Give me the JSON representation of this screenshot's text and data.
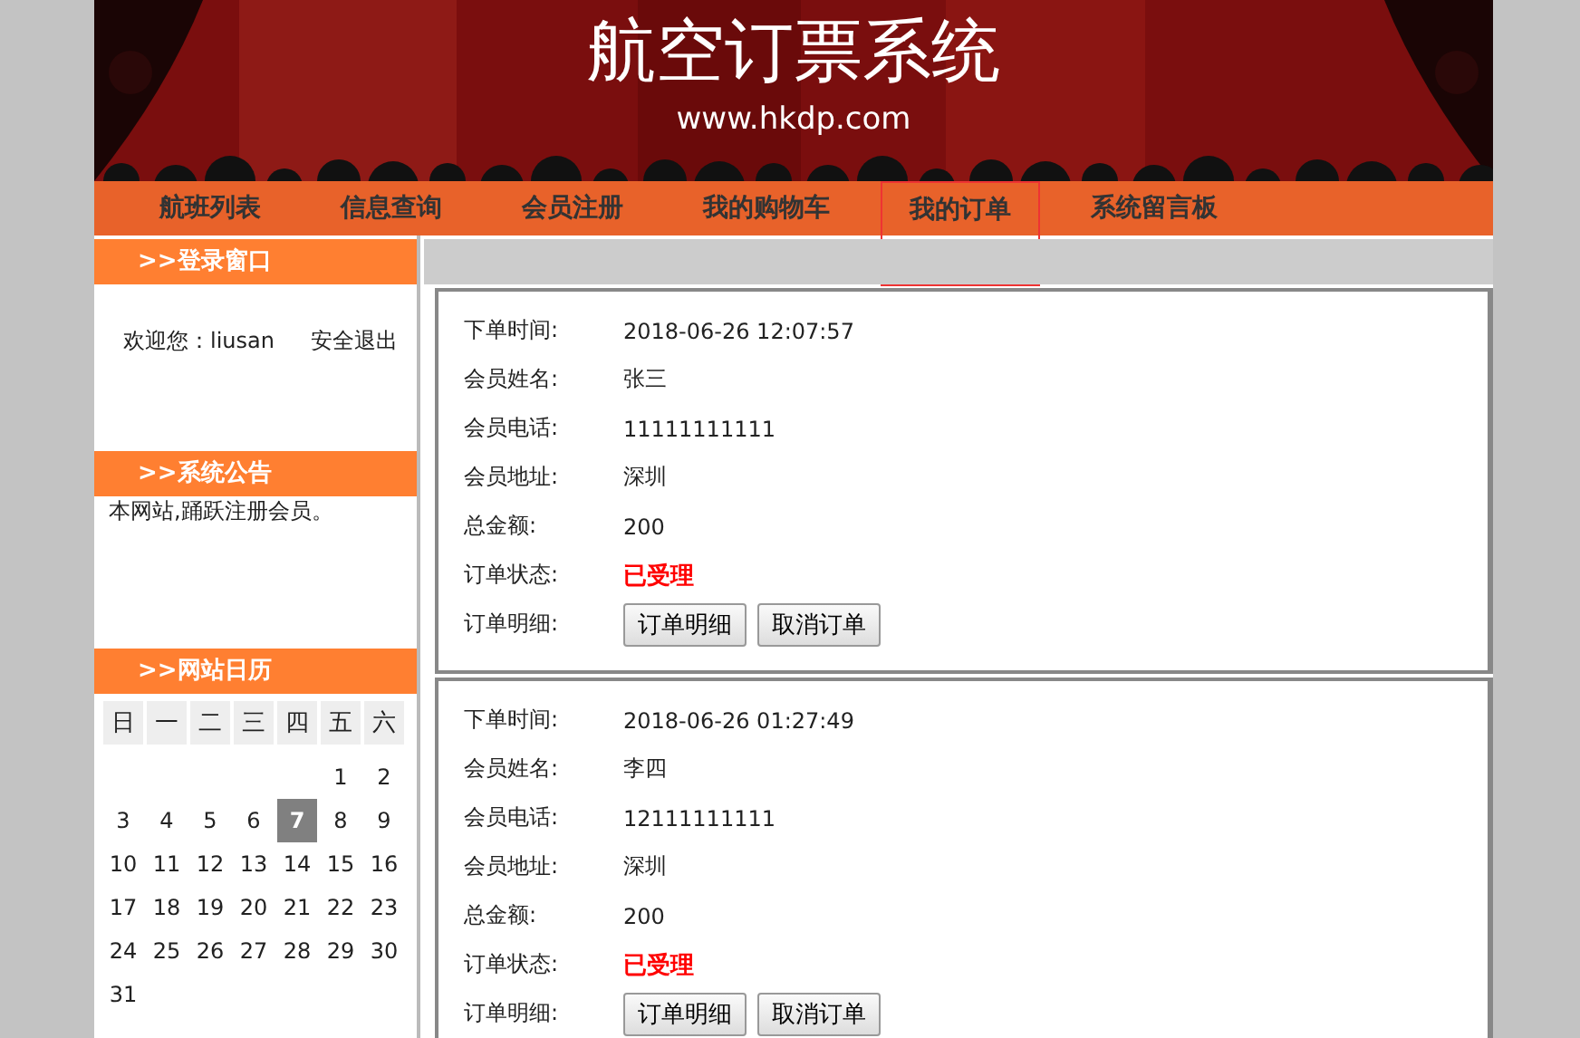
{
  "banner": {
    "title": "航空订票系统",
    "url": "www.hkdp.com"
  },
  "nav": [
    {
      "label": "航班列表",
      "selected": false
    },
    {
      "label": "信息查询",
      "selected": false
    },
    {
      "label": "会员注册",
      "selected": false
    },
    {
      "label": "我的购物车",
      "selected": false
    },
    {
      "label": "我的订单",
      "selected": true
    },
    {
      "label": "系统留言板",
      "selected": false
    }
  ],
  "login": {
    "title": ">>登录窗口",
    "welcome": "欢迎您：liusan",
    "logout": "安全退出"
  },
  "notice": {
    "title": ">>系统公告",
    "text": "本网站,踊跃注册会员。"
  },
  "calendar": {
    "title": ">>网站日历",
    "weekdays": [
      "日",
      "一",
      "二",
      "三",
      "四",
      "五",
      "六"
    ],
    "days": [
      {
        "day": "1",
        "selected": false
      },
      {
        "day": "2",
        "selected": false
      },
      {
        "day": "3",
        "selected": false
      },
      {
        "day": "4",
        "selected": false
      },
      {
        "day": "5",
        "selected": false
      },
      {
        "day": "6",
        "selected": false
      },
      {
        "day": "7",
        "selected": true
      },
      {
        "day": "8",
        "selected": false
      },
      {
        "day": "9",
        "selected": false
      },
      {
        "day": "10",
        "selected": false
      },
      {
        "day": "11",
        "selected": false
      },
      {
        "day": "12",
        "selected": false
      },
      {
        "day": "13",
        "selected": false
      },
      {
        "day": "14",
        "selected": false
      },
      {
        "day": "15",
        "selected": false
      },
      {
        "day": "16",
        "selected": false
      },
      {
        "day": "17",
        "selected": false
      },
      {
        "day": "18",
        "selected": false
      },
      {
        "day": "19",
        "selected": false
      },
      {
        "day": "20",
        "selected": false
      },
      {
        "day": "21",
        "selected": false
      },
      {
        "day": "22",
        "selected": false
      },
      {
        "day": "23",
        "selected": false
      },
      {
        "day": "24",
        "selected": false
      },
      {
        "day": "25",
        "selected": false
      },
      {
        "day": "26",
        "selected": false
      },
      {
        "day": "27",
        "selected": false
      },
      {
        "day": "28",
        "selected": false
      },
      {
        "day": "29",
        "selected": false
      },
      {
        "day": "30",
        "selected": false
      },
      {
        "day": "31",
        "selected": false
      }
    ]
  },
  "orders": [
    {
      "fields": [
        {
          "label": "下单时间:",
          "value": "2018-06-26 12:07:57",
          "kind": "text"
        },
        {
          "label": "会员姓名:",
          "value": "张三",
          "kind": "text"
        },
        {
          "label": "会员电话:",
          "value": "11111111111",
          "kind": "text"
        },
        {
          "label": "会员地址:",
          "value": "深圳",
          "kind": "text"
        },
        {
          "label": "总金额:",
          "value": "200",
          "kind": "text"
        },
        {
          "label": "订单状态:",
          "value": "已受理",
          "kind": "status"
        }
      ],
      "actions_label": "订单明细:",
      "buttons": [
        "订单明细",
        "取消订单"
      ]
    },
    {
      "fields": [
        {
          "label": "下单时间:",
          "value": "2018-06-26 01:27:49",
          "kind": "text"
        },
        {
          "label": "会员姓名:",
          "value": "李四",
          "kind": "text"
        },
        {
          "label": "会员电话:",
          "value": "12111111111",
          "kind": "text"
        },
        {
          "label": "会员地址:",
          "value": "深圳",
          "kind": "text"
        },
        {
          "label": "总金额:",
          "value": "200",
          "kind": "text"
        },
        {
          "label": "订单状态:",
          "value": "已受理",
          "kind": "status"
        }
      ],
      "actions_label": "订单明细:",
      "buttons": [
        "订单明细",
        "取消订单"
      ]
    }
  ]
}
